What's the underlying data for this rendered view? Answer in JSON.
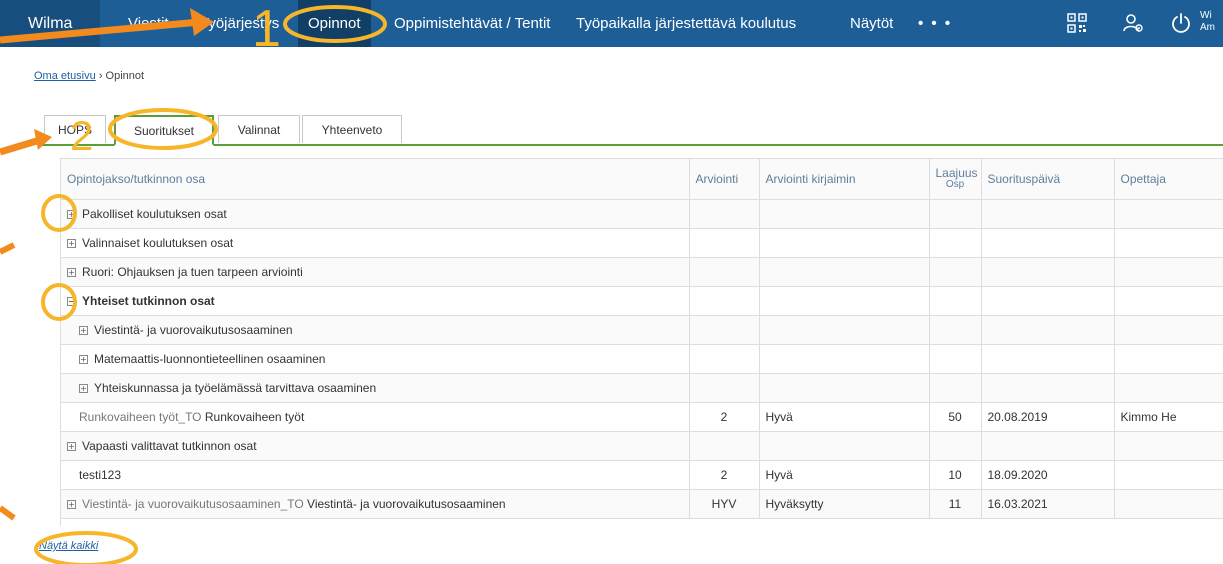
{
  "nav": {
    "brand": "Wilma",
    "items": [
      "Viestit",
      "Työjärjestys",
      "Opinnot",
      "Oppimistehtävät / Tentit",
      "Työpaikalla järjestettävä koulutus",
      "Näytöt"
    ],
    "more": "• • •",
    "active_index": 2,
    "user_snip": [
      "Wi",
      "Am"
    ],
    "icons": [
      "qr-code-icon",
      "user-settings-icon",
      "power-icon"
    ]
  },
  "breadcrumb": {
    "home": "Oma etusivu",
    "sep": "›",
    "current": "Opinnot"
  },
  "tabs": [
    "HOPS",
    "Suoritukset",
    "Valinnat",
    "Yhteenveto"
  ],
  "table": {
    "headers": {
      "course": "Opintojakso/tutkinnon osa",
      "grade": "Arviointi",
      "grade_letter": "Arviointi kirjaimin",
      "scope": "Laajuus",
      "scope_unit": "Osp",
      "date": "Suorituspäivä",
      "teacher": "Opettaja"
    },
    "rows": [
      {
        "toggle": "+",
        "name": "Pakolliset koulutuksen osat"
      },
      {
        "toggle": "+",
        "name": "Valinnaiset koulutuksen osat"
      },
      {
        "toggle": "+",
        "name": "Ruori: Ohjauksen ja tuen tarpeen arviointi"
      },
      {
        "toggle": "−",
        "name": "Yhteiset tutkinnon osat"
      },
      {
        "toggle": "+",
        "name": "Viestintä- ja vuorovaikutusosaaminen"
      },
      {
        "toggle": "+",
        "name": "Matemaattis-luonnontieteellinen osaaminen"
      },
      {
        "toggle": "+",
        "name": "Yhteiskunnassa ja työelämässä tarvittava osaaminen"
      },
      {
        "code": "Runkovaiheen työt_TO",
        "name": "Runkovaiheen työt",
        "grade": "2",
        "grade_letter": "Hyvä",
        "scope": "50",
        "date": "20.08.2019",
        "teacher": "Kimmo He"
      },
      {
        "toggle": "+",
        "name": "Vapaasti valittavat tutkinnon osat"
      },
      {
        "name": "testi123",
        "grade": "2",
        "grade_letter": "Hyvä",
        "scope": "10",
        "date": "18.09.2020"
      },
      {
        "toggle": "+",
        "code": "Viestintä- ja vuorovaikutusosaaminen_TO",
        "name": "Viestintä- ja vuorovaikutusosaaminen",
        "grade": "HYV",
        "grade_letter": "Hyväksytty",
        "scope": "11",
        "date": "16.03.2021"
      }
    ]
  },
  "show_all": "Näytä kaikki",
  "annotations": {
    "number_1": "1",
    "number_2": "2",
    "highlight_color": "#f7b52a",
    "arrow_color": "#f28a1e"
  }
}
